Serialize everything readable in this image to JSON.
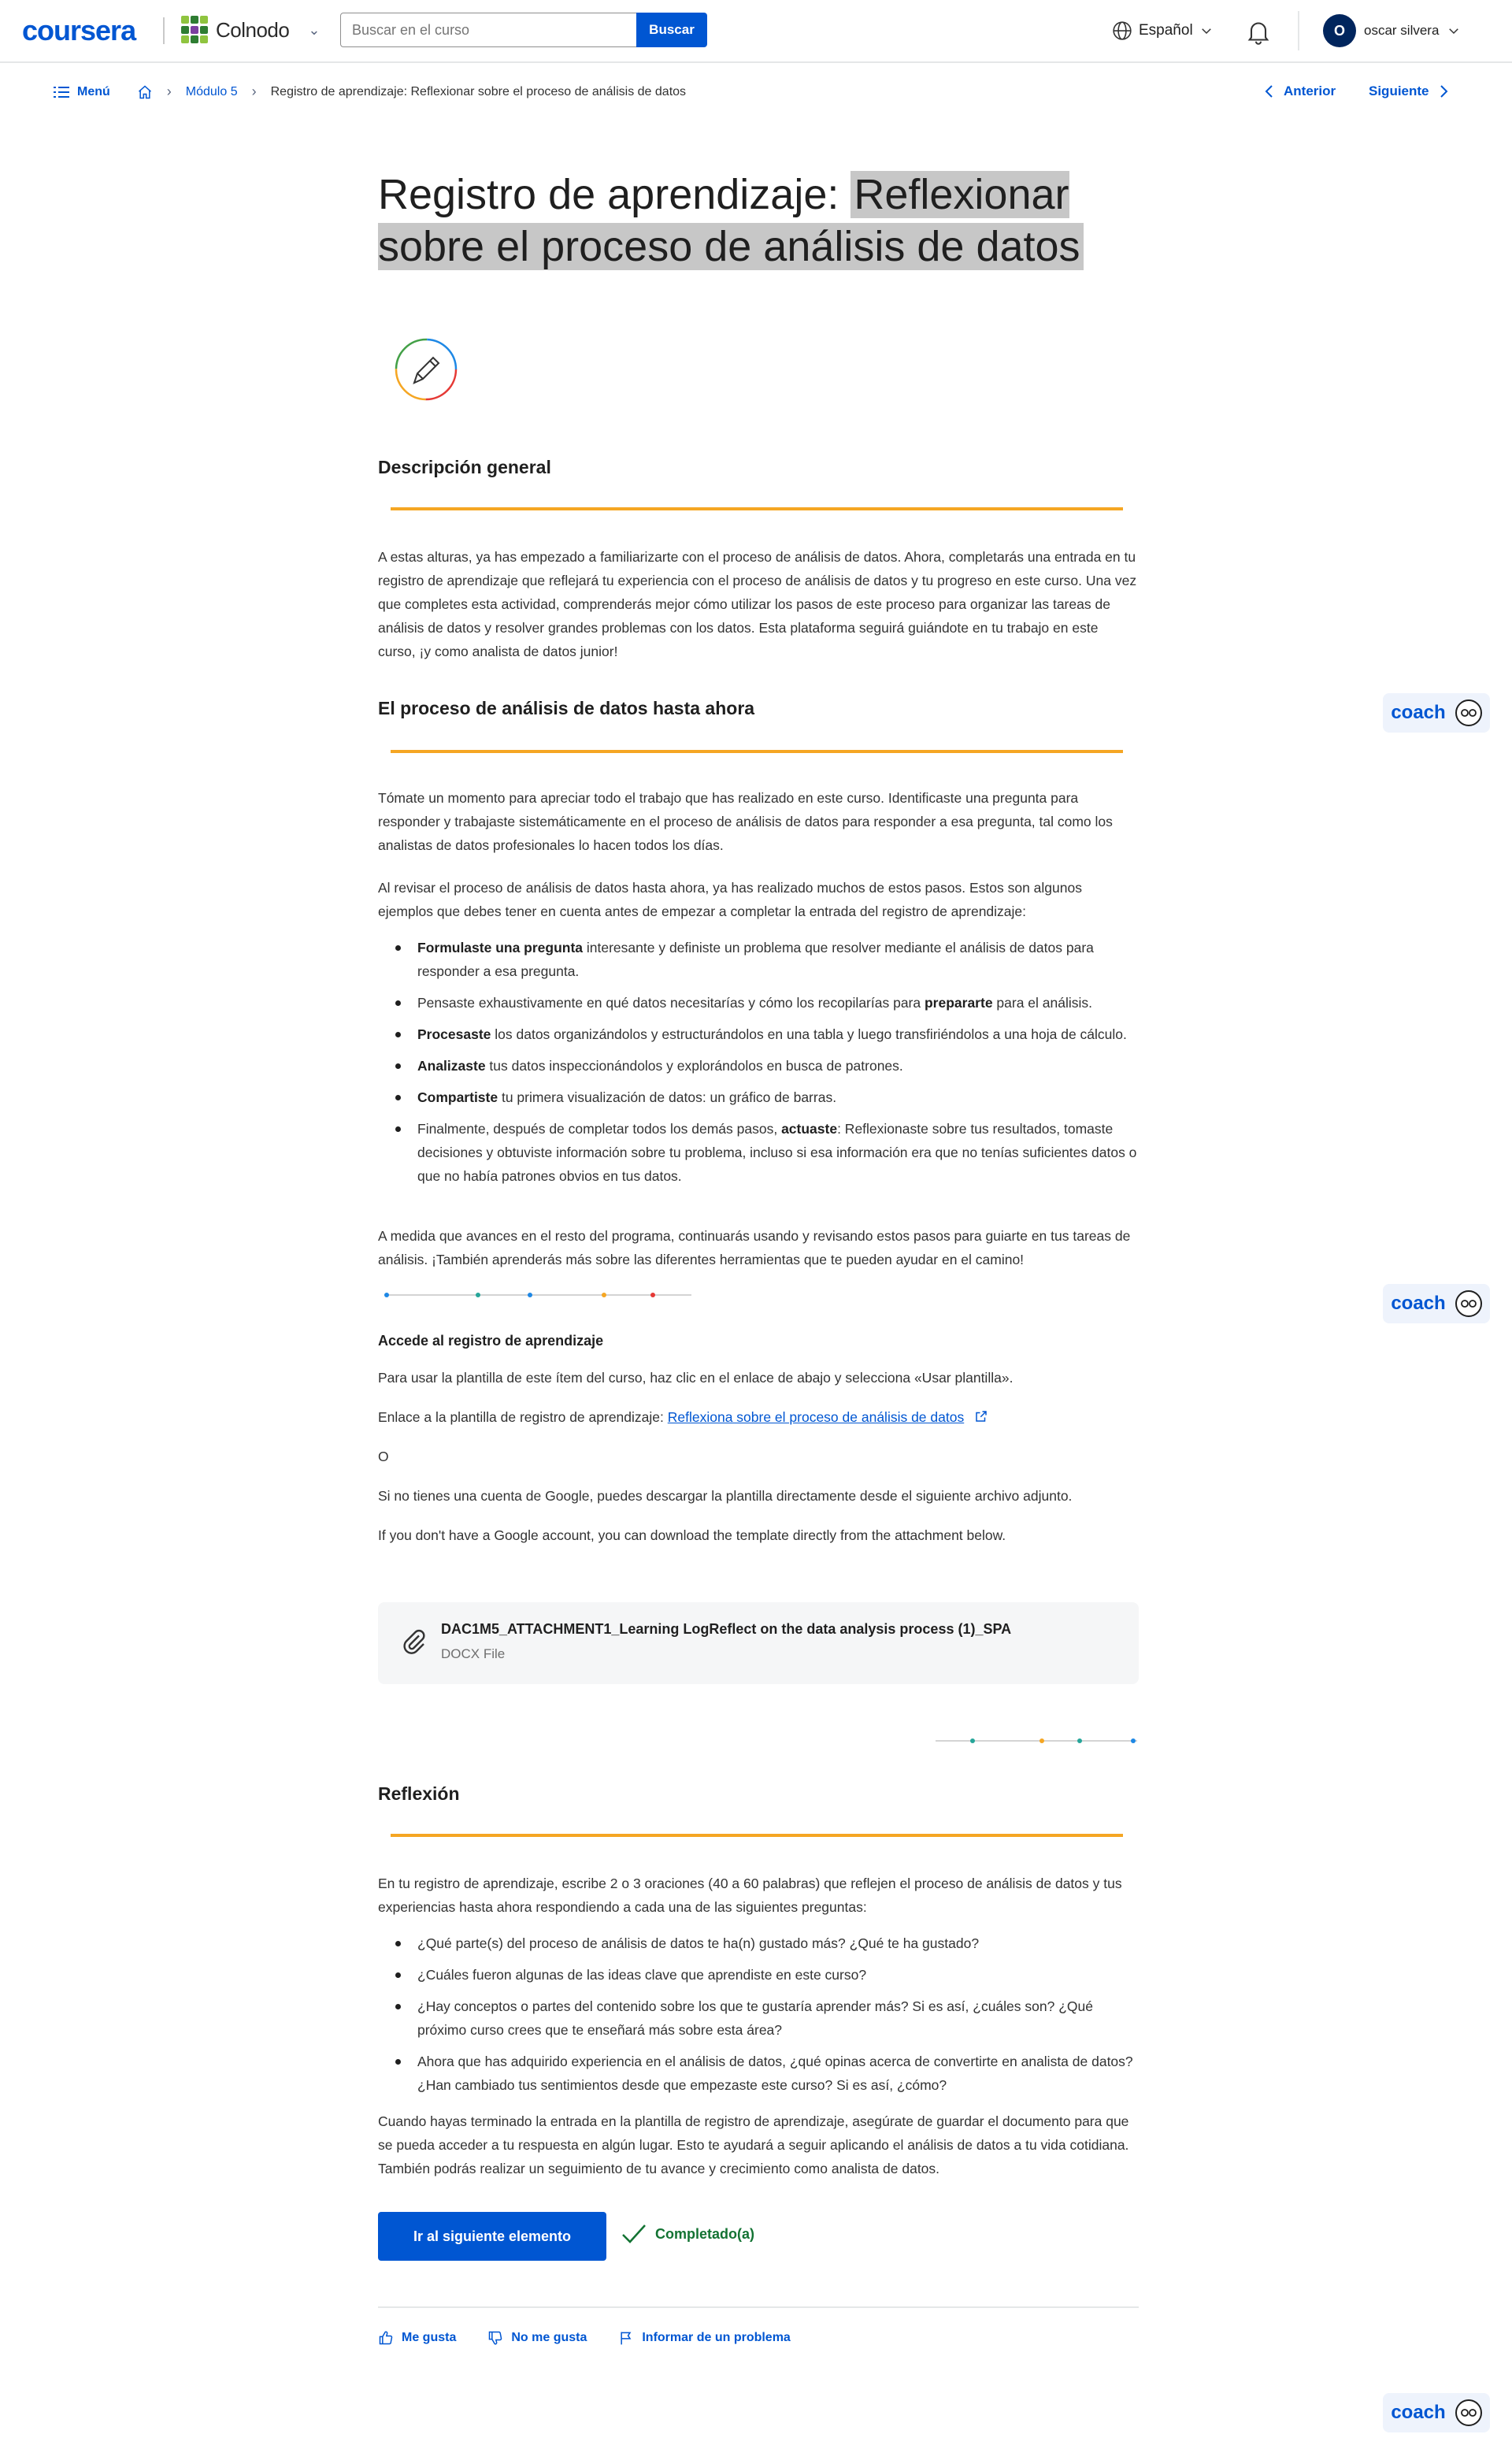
{
  "header": {
    "logo": "coursera",
    "partner": "Colnodo",
    "search_placeholder": "Buscar en el curso",
    "search_button": "Buscar",
    "language": "Español",
    "avatar_letter": "O",
    "user_name": "oscar silvera"
  },
  "breadcrumb": {
    "menu": "Menú",
    "module": "Módulo 5",
    "current": "Registro de aprendizaje: Reflexionar sobre el proceso de análisis de datos",
    "prev": "Anterior",
    "next": "Siguiente"
  },
  "page": {
    "title_a": "Registro de aprendizaje: ",
    "title_b": "Reflexionar sobre el proceso de análisis de datos"
  },
  "overview": {
    "heading": "Descripción general",
    "text": "A estas alturas, ya has empezado a familiarizarte con el proceso de análisis de datos. Ahora, completarás una entrada en tu registro de aprendizaje que reflejará tu experiencia con el proceso de análisis de datos y tu progreso en este curso. Una vez que completes esta actividad, comprenderás mejor cómo utilizar los pasos de este proceso para organizar las tareas de análisis de datos y resolver grandes problemas con los datos. Esta plataforma seguirá guiándote en tu trabajo en este curso, ¡y como analista de datos junior!"
  },
  "process": {
    "heading": "El proceso de análisis de datos hasta ahora",
    "p1": "Tómate un momento para apreciar todo el trabajo que has realizado en este curso. Identificaste una pregunta para responder y trabajaste sistemáticamente en el proceso de análisis de datos para responder a esa pregunta, tal como los analistas de datos profesionales lo hacen todos los días.",
    "p2": "Al revisar el proceso de análisis de datos hasta ahora, ya has realizado muchos de estos pasos. Estos son algunos ejemplos que debes tener en cuenta antes de empezar a completar la entrada del registro de aprendizaje:",
    "b1_bold": "Formulaste una pregunta",
    "b1_rest": " interesante y definiste un problema que resolver mediante el análisis de datos para responder a esa pregunta.",
    "b2_a": "Pensaste exhaustivamente en qué datos necesitarías y cómo los recopilarías para ",
    "b2_bold": "prepararte",
    "b2_b": " para el análisis.",
    "b3_bold": "Procesaste",
    "b3_rest": " los datos organizándolos y estructurándolos en una tabla y luego transfiriéndolos a una hoja de cálculo.",
    "b4_bold": "Analizaste",
    "b4_rest": " tus datos inspeccionándolos y explorándolos en busca de patrones.",
    "b5_bold": "Compartiste",
    "b5_rest": " tu primera visualización de datos: un gráfico de barras.",
    "b6_a": "Finalmente, después de completar todos los demás pasos, ",
    "b6_bold": "actuaste",
    "b6_b": ": Reflexionaste sobre tus resultados, tomaste decisiones y obtuviste información sobre tu problema, incluso si esa información era que no tenías suficientes datos o que no había patrones obvios en tus datos.",
    "p3": "A medida que avances en el resto del programa, continuarás usando y revisando estos pasos para guiarte en tus tareas de análisis. ¡También aprenderás más sobre las diferentes herramientas que te pueden ayudar en el camino!"
  },
  "access": {
    "heading": "Accede al registro de aprendizaje",
    "p1": "Para usar la plantilla de este ítem del curso, haz clic en el enlace de abajo y selecciona «Usar plantilla».",
    "p2_prefix": "Enlace a la plantilla de registro de aprendizaje: ",
    "p2_link": "Reflexiona sobre el proceso de análisis de datos",
    "or": "O",
    "p3": "Si no tienes una cuenta de Google, puedes descargar la plantilla directamente desde el siguiente archivo adjunto.",
    "p4": "If you don't have a Google account, you can download the template directly from the attachment below."
  },
  "attachment": {
    "name": "DAC1M5_ATTACHMENT1_Learning LogReflect on the data analysis process (1)_SPA",
    "type": "DOCX File"
  },
  "reflection": {
    "heading": "Reflexión",
    "intro": "En tu registro de aprendizaje, escribe 2 o 3 oraciones (40 a 60 palabras) que reflejen el proceso de análisis de datos y tus experiencias hasta ahora respondiendo a cada una de las siguientes preguntas:",
    "q1": "¿Qué parte(s) del proceso de análisis de datos te ha(n) gustado más? ¿Qué te ha gustado?",
    "q2": "¿Cuáles fueron algunas de las ideas clave que aprendiste en este curso?",
    "q3": "¿Hay conceptos o partes del contenido sobre los que te gustaría aprender más? Si es así, ¿cuáles son? ¿Qué próximo curso crees que te enseñará más sobre esta área?",
    "q4": "Ahora que has adquirido experiencia en el análisis de datos, ¿qué opinas acerca de convertirte en analista de datos? ¿Han cambiado tus sentimientos desde que empezaste este curso? Si es así, ¿cómo?",
    "closing": "Cuando hayas terminado la entrada en la plantilla de registro de aprendizaje, asegúrate de guardar el documento para que se pueda acceder a tu respuesta en algún lugar. Esto te ayudará a seguir aplicando el análisis de datos a tu vida cotidiana. También podrás realizar un seguimiento de tu avance y crecimiento como analista de datos."
  },
  "actions": {
    "next_item": "Ir al siguiente elemento",
    "completed": "Completado(a)",
    "like": "Me gusta",
    "dislike": "No me gusta",
    "report": "Informar de un problema"
  },
  "coach": {
    "label": "coach"
  },
  "colors": {
    "brand": "#0056d2",
    "accent_rule": "#f5a623",
    "success": "#137333"
  }
}
